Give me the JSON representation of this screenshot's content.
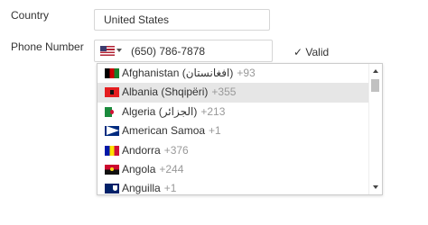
{
  "form": {
    "country_label": "Country",
    "country_value": "United States",
    "phone_label": "Phone Number",
    "phone_value": "(650) 786-7878",
    "selected_flag": "us-flag-icon",
    "valid_text": "✓ Valid"
  },
  "dropdown": {
    "items": [
      {
        "name": "Afghanistan (‫افغانستان‬‎)",
        "dial": "+93",
        "flag": "af-flag-icon"
      },
      {
        "name": "Albania (Shqipëri)",
        "dial": "+355",
        "flag": "al-flag-icon"
      },
      {
        "name": "Algeria (‫الجزائر‬‎)",
        "dial": "+213",
        "flag": "dz-flag-icon"
      },
      {
        "name": "American Samoa",
        "dial": "+1",
        "flag": "as-flag-icon"
      },
      {
        "name": "Andorra",
        "dial": "+376",
        "flag": "ad-flag-icon"
      },
      {
        "name": "Angola",
        "dial": "+244",
        "flag": "ao-flag-icon"
      },
      {
        "name": "Anguilla",
        "dial": "+1",
        "flag": "ai-flag-icon"
      }
    ],
    "highlighted_index": 1
  },
  "colors": {
    "highlight_bg": "#e6e6e6",
    "dial_code": "#999999",
    "border": "#d6d6d6"
  }
}
